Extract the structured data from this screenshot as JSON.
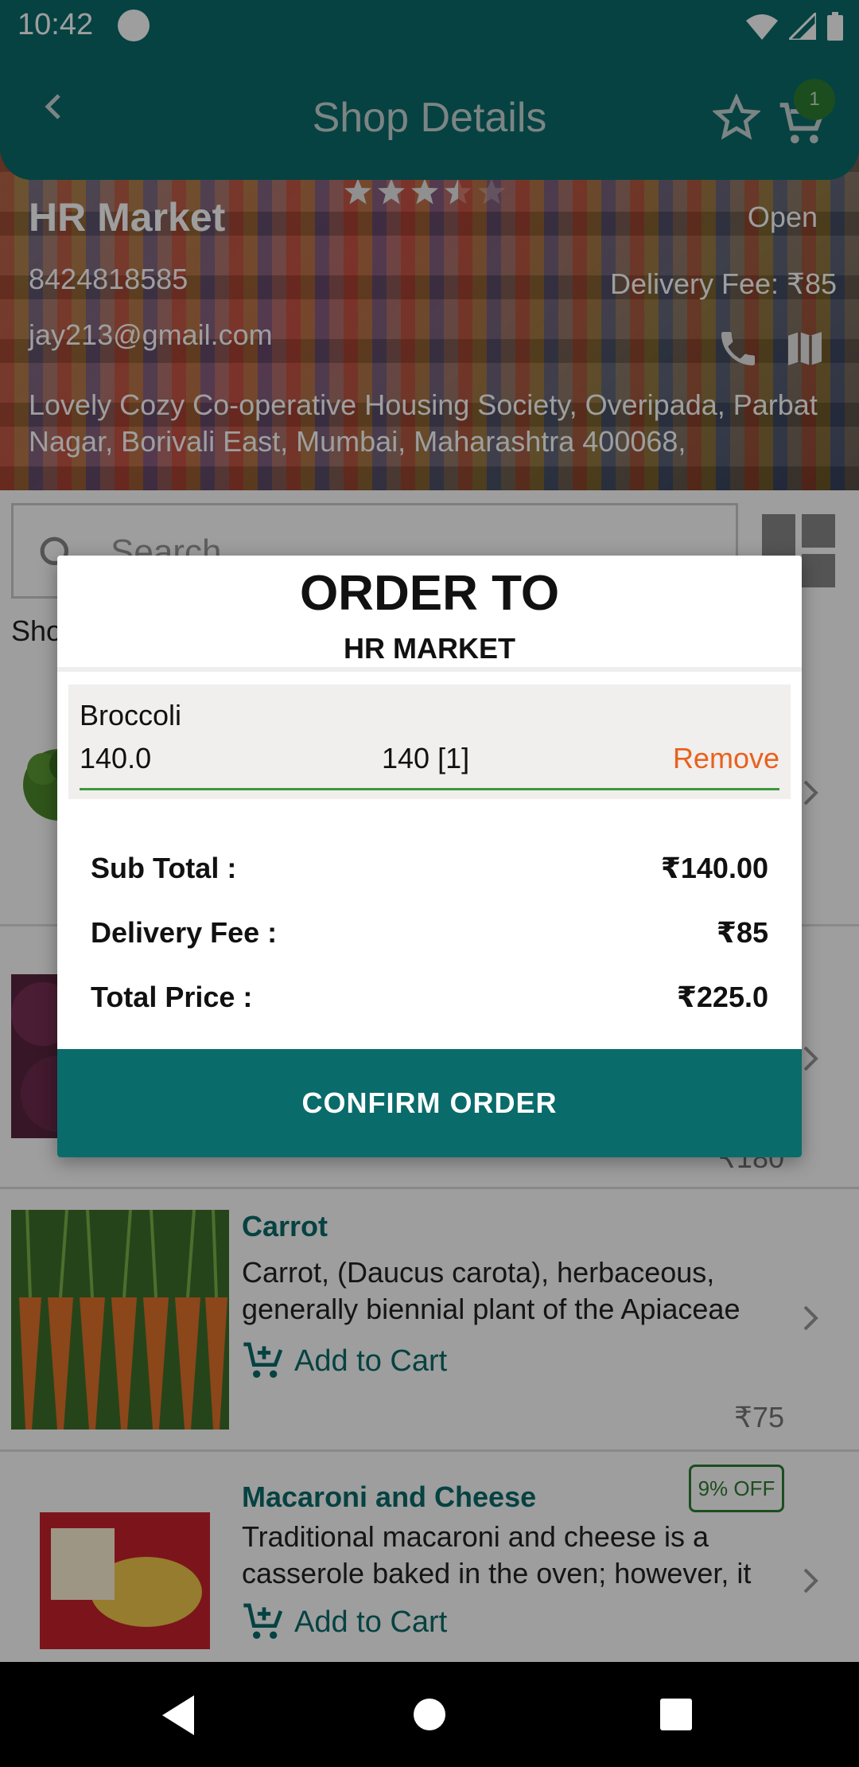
{
  "status_bar": {
    "time": "10:42"
  },
  "app_bar": {
    "title": "Shop Details",
    "cart_count": "1"
  },
  "shop": {
    "name": "HR Market",
    "rating": 3.5,
    "status": "Open",
    "phone": "8424818585",
    "delivery_fee": "Delivery Fee: ₹85",
    "email": "jay213@gmail.com",
    "address": "Lovely Cozy Co-operative Housing Society, Overipada, Parbat Nagar, Borivali East, Mumbai, Maharashtra 400068,"
  },
  "search": {
    "placeholder": "Search"
  },
  "section_label": "Sho",
  "products": [
    {
      "name": "Carrot",
      "description": "Carrot, (Daucus carota), herbaceous, generally biennial plant of the Apiaceae",
      "add_label": "Add to Cart",
      "price": "₹75"
    },
    {
      "name": "Macaroni and Cheese",
      "description": "Traditional macaroni and cheese is a casserole baked in the oven; however, it",
      "add_label": "Add to Cart",
      "discount": "9% OFF"
    }
  ],
  "hidden_price": "₹180",
  "dialog": {
    "title": "ORDER TO",
    "subtitle": "HR MARKET",
    "item": {
      "name": "Broccoli",
      "price": "140.0",
      "qty": "140 [1]",
      "remove": "Remove"
    },
    "sub_total_label": "Sub Total :",
    "sub_total": "₹140.00",
    "delivery_label": "Delivery Fee :",
    "delivery_value": "₹85",
    "total_label": "Total Price :",
    "total_value": "₹225.0",
    "confirm": "CONFIRM ORDER"
  }
}
